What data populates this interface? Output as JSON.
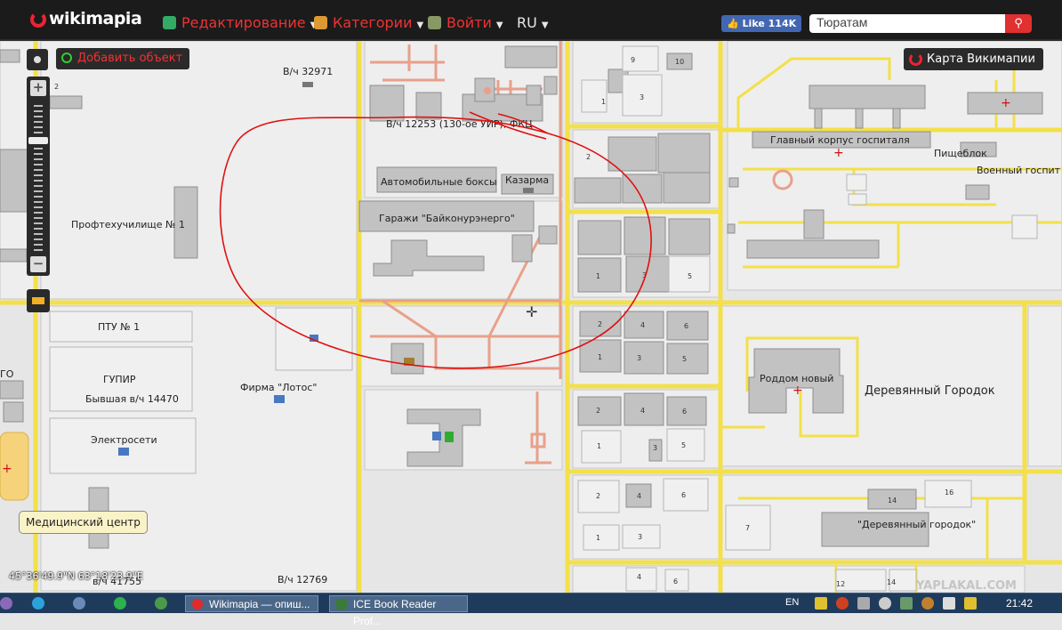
{
  "header": {
    "logo": "wikimapia",
    "menu": [
      {
        "label": "Редактирование",
        "color": "#e33333"
      },
      {
        "label": "Категории",
        "color": "#e33333"
      },
      {
        "label": "Войти",
        "color": "#e33333"
      },
      {
        "label": "RU",
        "color": "#ffffff"
      }
    ],
    "like_label": "Like 114K",
    "search_value": "Тюратам"
  },
  "map_controls": {
    "add_object_label": "Добавить объект",
    "map_switch_label": "Карта Викимапии",
    "zoom_in": "+",
    "zoom_out": "−"
  },
  "map": {
    "labels": [
      "В/ч 32971",
      "В/ч 12253 (130-ое УИР), ФКЦ",
      "Автомобильные боксы",
      "Казарма",
      "Гаражи \"Байконурэнерго\"",
      "Профтехучилище № 1",
      "ПТУ № 1",
      "ГУПИР",
      "Бывшая в/ч 14470",
      "Фирма \"Лотос\"",
      "Электросети",
      "Главный корпус госпиталя",
      "Пищеблок",
      "Военный госпит",
      "Роддом новый",
      "Деревянный Городок",
      "\"Деревянный городок\"",
      "В/ч 12769",
      "в/ч 41755"
    ],
    "numbers": [
      "9",
      "10",
      "3",
      "1",
      "2",
      "1",
      "3",
      "5",
      "2",
      "4",
      "6",
      "1",
      "3",
      "5",
      "2",
      "4",
      "6",
      "1",
      "3",
      "5",
      "2",
      "4",
      "6",
      "1",
      "3",
      "4",
      "6",
      "7",
      "14",
      "16",
      "12",
      "14",
      "2"
    ],
    "tooltip": "Медицинский центр",
    "coordinates": "45°36'49.9\"N 63°18'23.9\"E",
    "road_color": "#f3e04a",
    "annotation_color": "#e01010"
  },
  "taskbar": {
    "tasks": [
      "Wikimapia — опиш...",
      "ICE Book Reader Prof..."
    ],
    "lang": "EN",
    "time": "21:42"
  },
  "watermark": "YAPLAKAL.COM"
}
